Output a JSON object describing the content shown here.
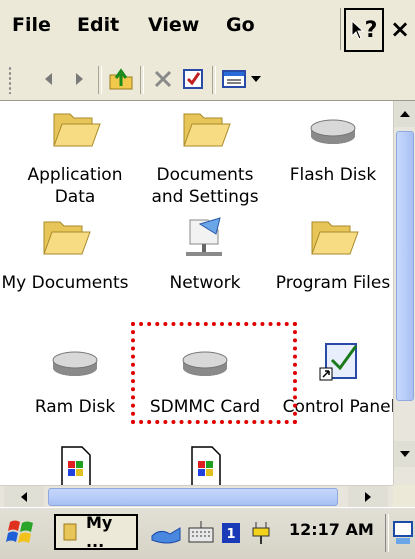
{
  "menubar": {
    "items": [
      "File",
      "Edit",
      "View",
      "Go"
    ],
    "help_label": "?",
    "close_label": "×"
  },
  "toolbar": {
    "icons": [
      "back-icon",
      "forward-icon",
      "up-folder-icon",
      "delete-icon",
      "properties-icon",
      "view-menu-icon"
    ]
  },
  "files": [
    {
      "label": "Application Data",
      "icon": "folder-icon"
    },
    {
      "label": "Documents and Settings",
      "icon": "folder-icon"
    },
    {
      "label": "Flash Disk",
      "icon": "storage-card-icon"
    },
    {
      "label": "My Documents",
      "icon": "folder-icon"
    },
    {
      "label": "Network",
      "icon": "network-icon"
    },
    {
      "label": "Program Files",
      "icon": "folder-icon"
    },
    {
      "label": "Ram Disk",
      "icon": "storage-card-icon"
    },
    {
      "label": "SDMMC Card",
      "icon": "storage-card-icon"
    },
    {
      "label": "Control Panel",
      "icon": "control-panel-icon"
    },
    {
      "label": "",
      "icon": "app-file-icon"
    },
    {
      "label": "",
      "icon": "app-file-icon"
    }
  ],
  "highlight": {
    "target": "SDMMC Card",
    "color": "#e00000"
  },
  "taskbar": {
    "task_label": "My ...",
    "clock": "12:17 AM",
    "tray_icons": [
      "network-connection-icon",
      "keyboard-icon",
      "input-indicator-icon",
      "power-icon"
    ]
  }
}
